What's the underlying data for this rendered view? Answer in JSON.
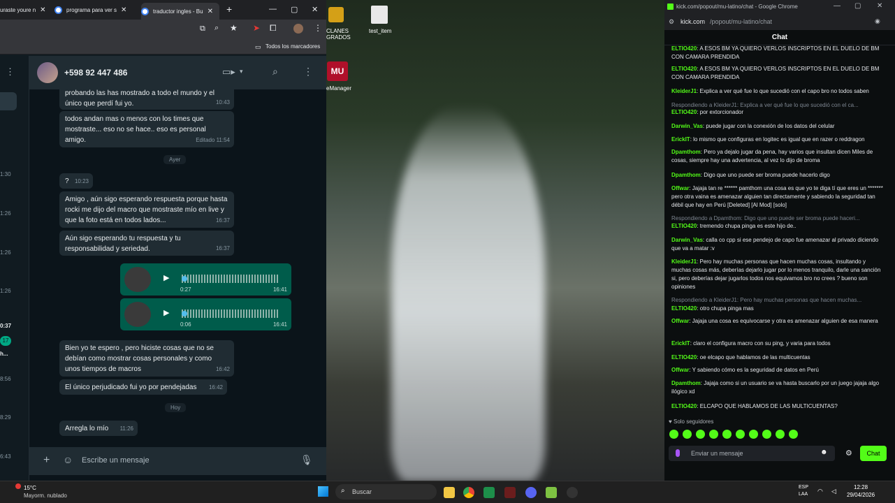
{
  "tabs": [
    {
      "label": "uraste youre n",
      "active": false
    },
    {
      "label": "programa para ver s",
      "active": false
    },
    {
      "label": "traductor ingles - Bu",
      "active": true
    }
  ],
  "bookmarks_label": "Todos los marcadores",
  "contact_name": "+598 92 447 486",
  "side_times": [
    "1:30",
    "1:26",
    "1:26",
    "1:26",
    "0:37",
    "8:56",
    "8:29",
    "6:43"
  ],
  "side_badge": "17",
  "side_small": "h...",
  "messages": [
    {
      "text": "probando las has mostrado a todo el mundo y el único que perdí fui yo.",
      "time": "10:43"
    },
    {
      "text": "todos andan mas o menos con los times que mostraste... eso no se hace.. eso es personal amigo.",
      "time": "Editado 11:54"
    },
    {
      "text": "?",
      "time": "10:23"
    },
    {
      "text": "Amigo , aún sigo esperando respuesta porque hasta rocki me dijo del macro que mostraste mío en live y que la foto está en todos lados...",
      "time": "16:37"
    },
    {
      "text": "Aún sigo esperando tu respuesta y tu responsabilidad y seriedad.",
      "time": "16:37"
    },
    {
      "text": "Bien yo te espero , pero hiciste cosas que no se debían como mostrar cosas personales y como unos tiempos de macros",
      "time": "16:42"
    },
    {
      "text": "El único perjudicado fui yo por pendejadas",
      "time": "16:42"
    },
    {
      "text": "Arregla lo mío",
      "time": "11:26"
    }
  ],
  "day_labels": [
    "Ayer",
    "Hoy"
  ],
  "voice_notes": [
    {
      "duration": "0:27",
      "time": "16:41"
    },
    {
      "duration": "0:06",
      "time": "16:41"
    }
  ],
  "compose_placeholder": "Escribe un mensaje",
  "desktop_icons": [
    {
      "label": "CLANES\nGRADOS"
    },
    {
      "label": "test_item"
    },
    {
      "label": "eManager"
    }
  ],
  "kick": {
    "window_title": "kick.com/popout/mu-latino/chat - Google Chrome",
    "url_domain": "kick.com",
    "url_path": "/popout/mu-latino/chat",
    "header": "Chat",
    "messages": [
      {
        "user": "ELTIO420",
        "text": ": A ESOS BM YA QUIERO VERLOS INSCRIPTOS EN EL DUELO DE BM CON CAMARA PRENDIDA"
      },
      {
        "user": "ELTIO420",
        "text": ": A ESOS BM YA QUIERO VERLOS INSCRIPTOS EN EL DUELO DE BM CON CAMARA PRENDIDA"
      },
      {
        "user": "KleiderJ1",
        "text": ": Explica a ver qué fue lo que sucedió con el capo bro no todos saben"
      },
      {
        "reply": "Respondiendo a KleiderJ1: Explica a ver qué fue lo que sucedió con el ca..."
      },
      {
        "user": "ELTIO420",
        "text": ": por extorcionador"
      },
      {
        "user": "Darwin_Vas",
        "text": ": puede jugar con la conexión de los datos del celular"
      },
      {
        "user": "ErickIT",
        "text": ": lo mismo que configuras en logitec es igual que en razer o reddragon"
      },
      {
        "user": "Dpamthom",
        "text": ": Pero ya dejalo jugar da pena, hay varios que insultan dicen Miles de cosas, siempre hay una advertencia, al vez lo dijo de broma"
      },
      {
        "user": "Dpamthom",
        "text": ": Digo que uno puede ser broma puede hacerlo digo"
      },
      {
        "user": "Offwar",
        "text": ": Jajaja tan re ****** pamthom una cosa es que yo te diga tí que eres un ******* pero otra vaina es amenazar alguien tan directamente y sabiendo la seguridad tan débil que hay en Perú [Deleted] [Al Mod] [solo]"
      },
      {
        "reply": "Respondiendo a Dpamthom: Digo que uno puede ser broma puede haceri..."
      },
      {
        "user": "ELTIO420",
        "text": ": tremendo chupa pinga es este hijo de.."
      },
      {
        "user": "Darwin_Vas",
        "text": ": calla co cpp si ese pendejo de capo fue amenazar al privado diciendo que va a matar :v"
      },
      {
        "user": "KleiderJ1",
        "text": ": Pero hay muchas personas que hacen muchas cosas, insultando y muchas cosas más, deberías dejarlo jugar por lo menos tranquilo, darle una sanción si, pero deberías dejar jugarlos todos nos equivamos bro no crees ? bueno son opiniones"
      },
      {
        "reply": "Respondiendo a KleiderJ1: Pero hay muchas personas que hacen muchas..."
      },
      {
        "user": "ELTIO420",
        "text": ": otro chupa pinga mas"
      },
      {
        "user": "Offwar",
        "text": ": Jajaja una cosa es equivocarse y otra es amenazar alguien de esa manera"
      },
      {
        "user": "ErickIT",
        "text": ": claro el configura macro con su ping, y varia para todos"
      },
      {
        "user": "ELTIO420",
        "text": ": oe elcapo que hablamos de las multicuentas"
      },
      {
        "user": "Offwar",
        "text": ": Y sabiendo cómo es la seguridad de datos en Perú"
      },
      {
        "user": "Dpamthom",
        "text": ": Jajaja como si un usuario se va hasta buscarlo por un juego jajaja algo ilógico xd"
      },
      {
        "user": "ELTIO420",
        "text": ": ELCAPO QUE HABLAMOS DE LAS MULTICUENTAS?"
      }
    ],
    "followers_only": "Solo seguidores",
    "input_placeholder": "Enviar un mensaje",
    "send_label": "Chat"
  },
  "taskbar": {
    "weather_temp": "15°C",
    "weather_desc": "Mayorm. nublado",
    "search_label": "Buscar",
    "lang": "ESP",
    "lang_sub": "LAA",
    "clock": "12:28",
    "date": "29/04/2026"
  }
}
